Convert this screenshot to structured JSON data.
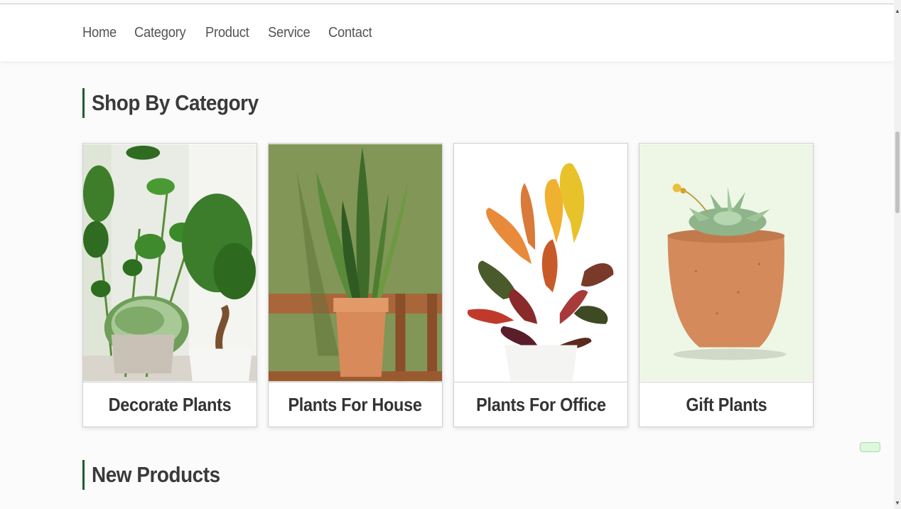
{
  "nav": {
    "items": [
      {
        "label": "Home"
      },
      {
        "label": "Category"
      },
      {
        "label": "Product"
      },
      {
        "label": "Service"
      },
      {
        "label": "Contact"
      }
    ]
  },
  "sections": {
    "category_title": "Shop By Category",
    "new_products_title": "New Products"
  },
  "categories": [
    {
      "label": "Decorate Plants",
      "image": "leafy houseplants by a window"
    },
    {
      "label": "Plants For House",
      "image": "snake plant in terracotta pot"
    },
    {
      "label": "Plants For Office",
      "image": "croton plant in white pot"
    },
    {
      "label": "Gift Plants",
      "image": "succulent in clay pot"
    }
  ],
  "colors": {
    "accent": "#1e5f2c",
    "heading_text": "#3a3a3a",
    "nav_text": "#555555"
  }
}
